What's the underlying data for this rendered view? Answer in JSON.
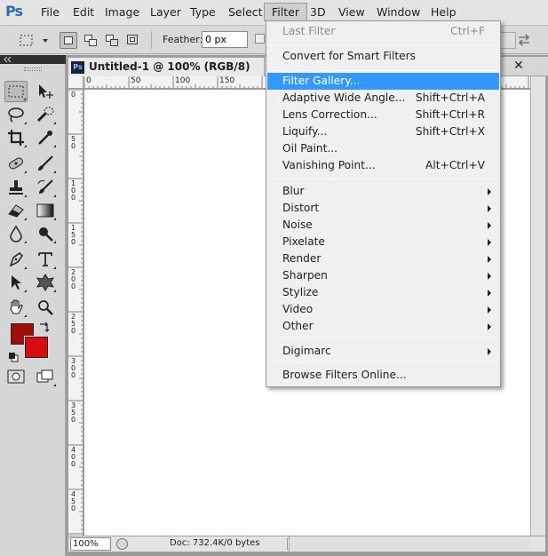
{
  "app": {
    "logo": "Ps"
  },
  "menubar": {
    "items": [
      {
        "label": "File"
      },
      {
        "label": "Edit"
      },
      {
        "label": "Image"
      },
      {
        "label": "Layer"
      },
      {
        "label": "Type"
      },
      {
        "label": "Select"
      },
      {
        "label": "Filter"
      },
      {
        "label": "3D"
      },
      {
        "label": "View"
      },
      {
        "label": "Window"
      },
      {
        "label": "Help"
      }
    ],
    "active": "Filter"
  },
  "options": {
    "feather_label": "Feather:",
    "feather_value": "0 px"
  },
  "document": {
    "tab_icon": "Ps",
    "title": "Untitled-1 @ 100% (RGB/8)",
    "close": "✕",
    "ruler_top": [
      "0",
      "50",
      "100",
      "150"
    ],
    "ruler_left": [
      "0",
      "5 0",
      "1 0 0",
      "1 5 0",
      "2 0 0",
      "2 5 0",
      "3 0 0",
      "3 5 0",
      "4 0 0",
      "4 5 0"
    ]
  },
  "status": {
    "zoom": "100%",
    "doc_info": "Doc: 732.4K/0 bytes"
  },
  "colors": {
    "foreground": "#9c0f0d",
    "background": "#d80c0c",
    "highlight": "#3399ff"
  },
  "filter_menu": {
    "last_filter": "Last Filter",
    "last_filter_sc": "Ctrl+F",
    "convert_smart": "Convert for Smart Filters",
    "filter_gallery": "Filter Gallery...",
    "adaptive_wide": "Adaptive Wide Angle...",
    "adaptive_wide_sc": "Shift+Ctrl+A",
    "lens_correction": "Lens Correction...",
    "lens_correction_sc": "Shift+Ctrl+R",
    "liquify": "Liquify...",
    "liquify_sc": "Shift+Ctrl+X",
    "oil_paint": "Oil Paint...",
    "vanishing_point": "Vanishing Point...",
    "vanishing_point_sc": "Alt+Ctrl+V",
    "blur": "Blur",
    "distort": "Distort",
    "noise": "Noise",
    "pixelate": "Pixelate",
    "render": "Render",
    "sharpen": "Sharpen",
    "stylize": "Stylize",
    "video": "Video",
    "other": "Other",
    "digimarc": "Digimarc",
    "browse_online": "Browse Filters Online..."
  }
}
